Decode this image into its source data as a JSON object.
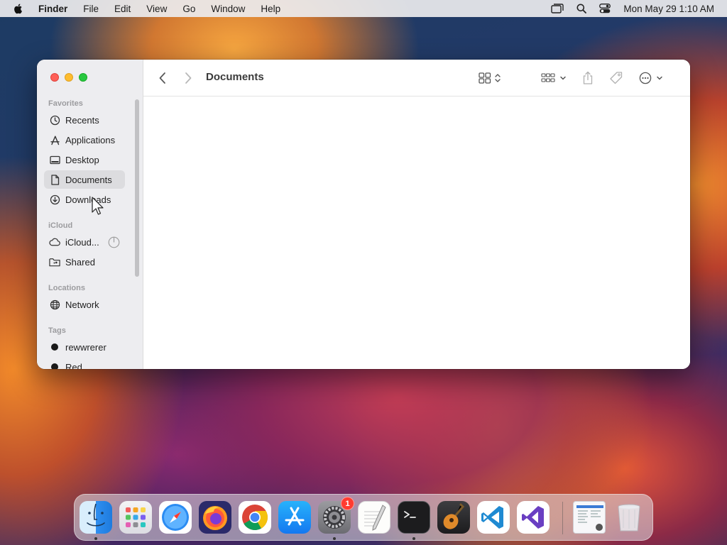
{
  "menubar": {
    "app_name": "Finder",
    "items": [
      "File",
      "Edit",
      "View",
      "Go",
      "Window",
      "Help"
    ],
    "clock": "Mon May 29  1:10 AM"
  },
  "window": {
    "title": "Documents"
  },
  "sidebar": {
    "sections": {
      "favorites": "Favorites",
      "icloud": "iCloud",
      "locations": "Locations",
      "tags": "Tags"
    },
    "favorites": [
      {
        "label": "Recents",
        "icon": "clock-icon"
      },
      {
        "label": "Applications",
        "icon": "applications-icon"
      },
      {
        "label": "Desktop",
        "icon": "desktop-icon"
      },
      {
        "label": "Documents",
        "icon": "document-icon",
        "selected": true
      },
      {
        "label": "Downloads",
        "icon": "download-icon"
      }
    ],
    "icloud": [
      {
        "label": "iCloud...",
        "icon": "cloud-icon"
      },
      {
        "label": "Shared",
        "icon": "shared-folder-icon"
      }
    ],
    "locations": [
      {
        "label": "Network",
        "icon": "globe-icon"
      }
    ],
    "tags": [
      {
        "label": "rewwrerer",
        "color": "#1a1a1a"
      },
      {
        "label": "Red",
        "color": "#1a1a1a"
      }
    ]
  },
  "dock": {
    "apps": [
      "Finder",
      "Launchpad",
      "Safari",
      "Firefox",
      "Chrome",
      "App Store",
      "System Settings",
      "TextEdit",
      "Terminal",
      "GarageBand",
      "Visual Studio Code",
      "Visual Studio",
      "Preview",
      "Trash"
    ],
    "settings_badge": "1"
  },
  "colors": {
    "close": "#fe5f57",
    "minimize": "#febc2e",
    "maximize": "#28c840",
    "badge": "#ff3b30"
  }
}
